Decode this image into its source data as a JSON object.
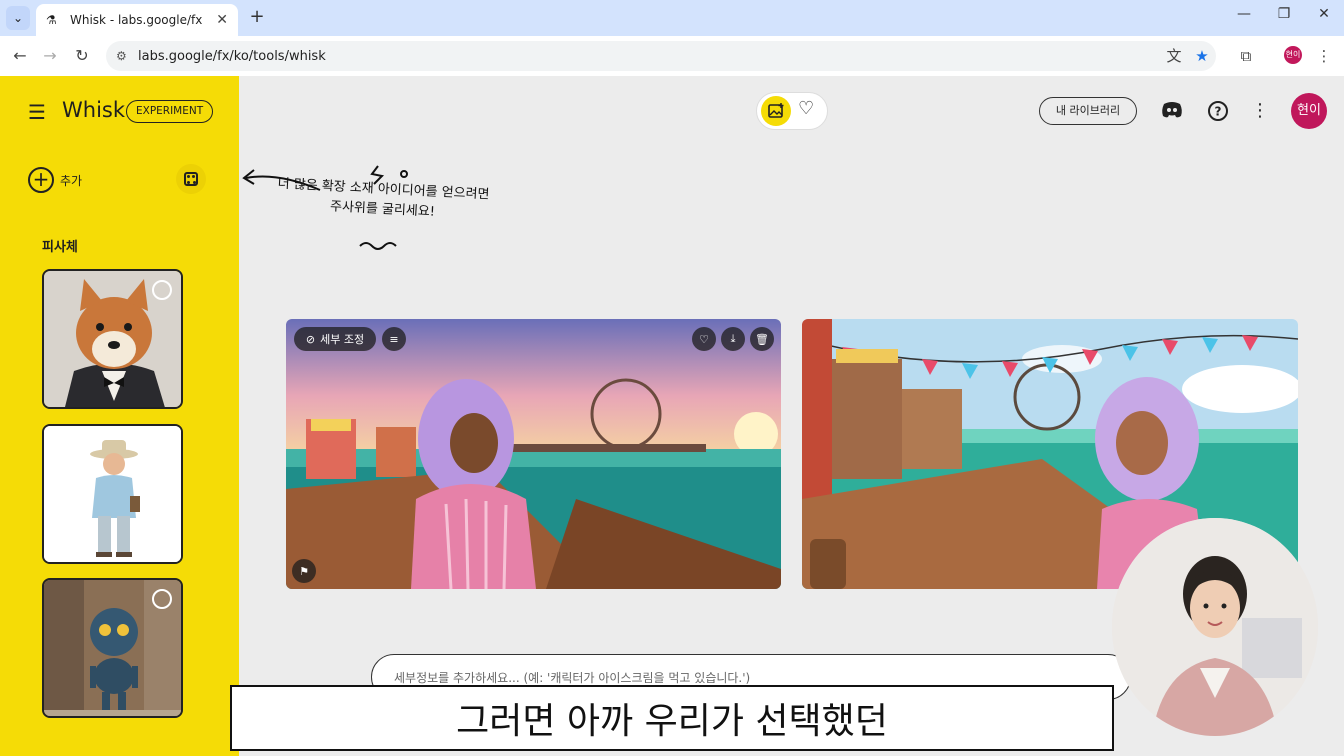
{
  "browser": {
    "tab_title": "Whisk - labs.google/fx",
    "url": "labs.google/fx/ko/tools/whisk",
    "profile_initials": "현이"
  },
  "app": {
    "brand": "Whisk",
    "badge": "EXPERIMENT",
    "add_label": "추가",
    "section_subjects": "피사체",
    "library_button": "내 라이브러리",
    "avatar_initials": "현이",
    "hint_line1": "더 많은 확장 소재 아이디어를 얻으려면",
    "hint_line2": "주사위를 굴리세요!",
    "refine_label": "세부 조정",
    "prompt_placeholder": "세부정보를 추가하세요... (예: '캐릭터가 아이스크림을 먹고 있습니다.')"
  },
  "subtitle": "그러면 아까 우리가 선택했던",
  "colors": {
    "sidebar": "#f5dc06",
    "avatar": "#c0175b"
  }
}
